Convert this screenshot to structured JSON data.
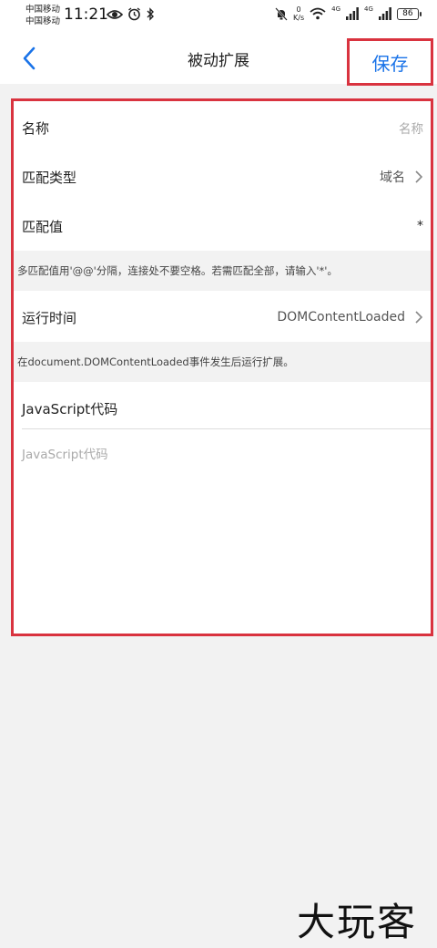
{
  "status_bar": {
    "carrier_1": "中国移动",
    "carrier_2": "中国移动",
    "time": "11:21",
    "net_speed_value": "0",
    "net_speed_unit": "K/s",
    "sim_1_network": "4G",
    "sim_2_network": "4G",
    "battery": "86"
  },
  "header": {
    "title": "被动扩展",
    "save_label": "保存"
  },
  "form": {
    "name": {
      "label": "名称",
      "placeholder": "名称"
    },
    "match_type": {
      "label": "匹配类型",
      "value": "域名"
    },
    "match_value": {
      "label": "匹配值",
      "value": "*"
    },
    "match_hint": "多匹配值用'@@'分隔，连接处不要空格。若需匹配全部，请输入'*'。",
    "run_at": {
      "label": "运行时间",
      "value": "DOMContentLoaded"
    },
    "run_hint": "在document.DOMContentLoaded事件发生后运行扩展。",
    "code": {
      "label": "JavaScript代码",
      "placeholder": "JavaScript代码"
    }
  },
  "watermark": "大玩客",
  "colors": {
    "accent": "#1a73e8",
    "highlight_border": "#d9333f",
    "page_background": "#f2f2f2"
  },
  "icons": {
    "back": "chevron-left-icon",
    "row_arrow": "chevron-right-icon",
    "eye": "eye-icon",
    "alarm": "alarm-icon",
    "bluetooth": "bluetooth-icon",
    "mute": "bell-off-icon",
    "wifi": "wifi-icon",
    "signal": "signal-icon",
    "battery": "battery-icon"
  }
}
